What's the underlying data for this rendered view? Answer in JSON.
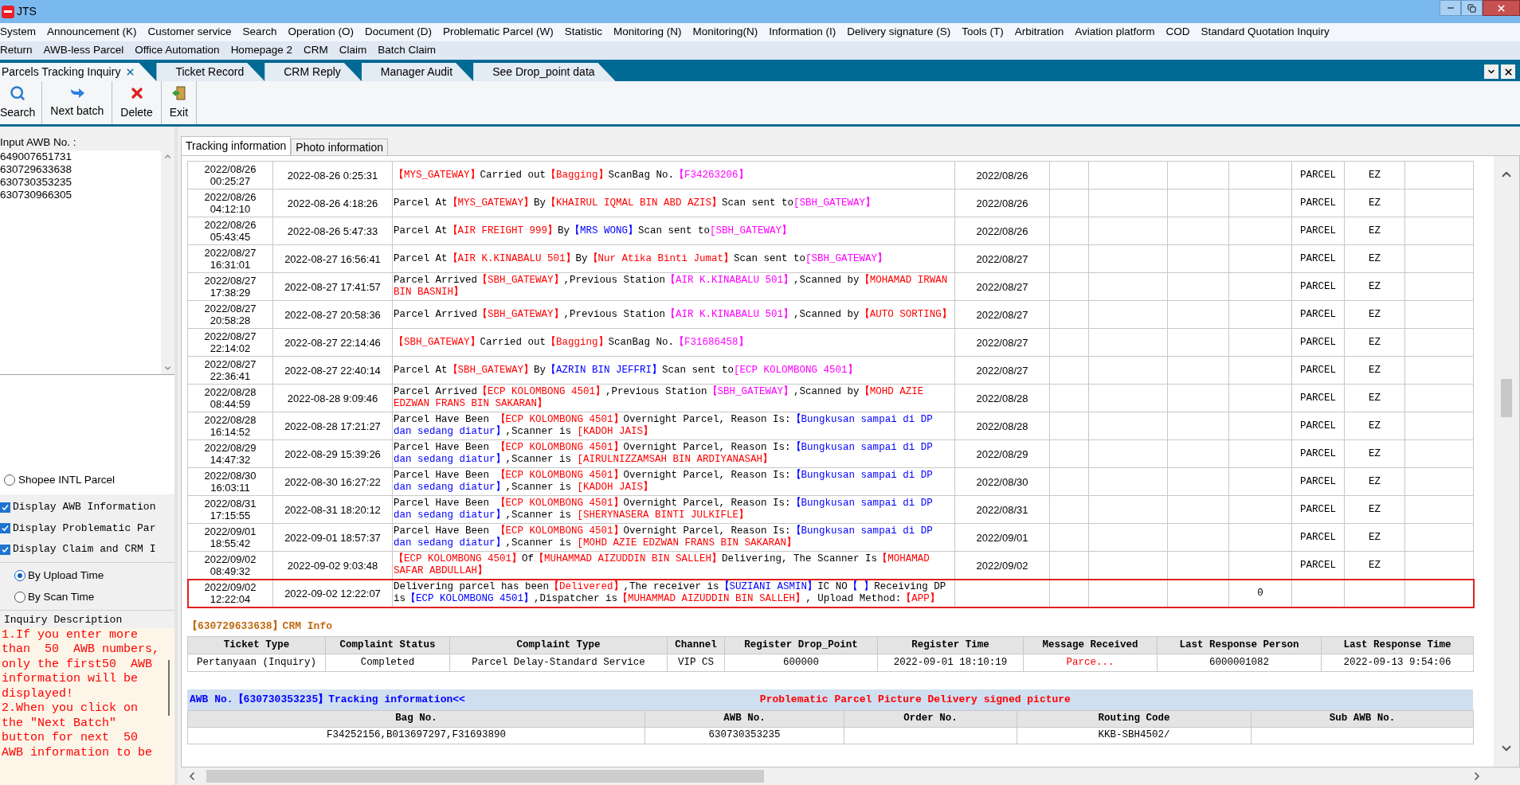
{
  "window": {
    "title": "JTS"
  },
  "menu_rows": [
    [
      "System",
      "Announcement (K)",
      "Customer service",
      "Search",
      "Operation (O)",
      "Document (D)",
      "Problematic Parcel (W)",
      "Statistic",
      "Monitoring (N)",
      "Monitoring(N)",
      "Information (I)",
      "Delivery signature (S)",
      "Tools (T)",
      "Arbitration",
      "Aviation platform",
      "COD",
      "Standard Quotation Inquiry"
    ],
    [
      "Return",
      "AWB-less Parcel",
      "Office Automation",
      "Homepage 2",
      "CRM",
      "Claim",
      "Batch Claim"
    ]
  ],
  "doc_tabs": [
    {
      "label": "Parcels Tracking Inquiry",
      "selected": true
    },
    {
      "label": "Ticket Record",
      "selected": false
    },
    {
      "label": "CRM Reply",
      "selected": false
    },
    {
      "label": "Manager Audit",
      "selected": false
    },
    {
      "label": "See Drop_point data",
      "selected": false
    }
  ],
  "toolbar": [
    {
      "kind": "search",
      "label": "Search"
    },
    {
      "kind": "next",
      "label": "Next batch"
    },
    {
      "kind": "delete",
      "label": "Delete"
    },
    {
      "kind": "exit",
      "label": "Exit"
    }
  ],
  "left_panel": {
    "awb_label": "Input AWB No. :",
    "awb_numbers": [
      "649007651731",
      "630729633638",
      "630730353235",
      "630730966305"
    ],
    "shopee_option": {
      "label": "Shopee INTL Parcel",
      "selected": false
    },
    "checkboxes": [
      {
        "label": "Display AWB Information",
        "checked": true
      },
      {
        "label": "Display Problematic Par",
        "checked": true
      },
      {
        "label": "Display Claim and CRM I",
        "checked": true
      }
    ],
    "sort_options": [
      {
        "label": "By Upload Time",
        "selected": true
      },
      {
        "label": "By Scan Time",
        "selected": false
      }
    ],
    "inquiry": {
      "title": "Inquiry Description",
      "text": "1.If you enter more than  50  AWB numbers, only the first50  AWB information will be displayed!\n2.When you click on the ″Next Batch″ button for next  50 AWB information to be"
    }
  },
  "content_tabs": [
    {
      "label": "Tracking information",
      "selected": true
    },
    {
      "label": "Photo information",
      "selected": false
    }
  ],
  "tracking": {
    "rows": [
      {
        "scan_date": "2022/08/26",
        "scan_time": "00:25:27",
        "upload_time": "2022-08-26 0:25:31",
        "description": [
          {
            "text": "【MYS_GATEWAY】",
            "color": "#ff0000"
          },
          {
            "text": "Carried out",
            "color": "#000000"
          },
          {
            "text": "【Bagging】",
            "color": "#ff0000"
          },
          {
            "text": "ScanBag No.",
            "color": "#000000"
          },
          {
            "text": "【F34263206】",
            "color": "#ff00ff"
          }
        ],
        "date": "2022/08/26",
        "type": "PARCEL",
        "code": "EZ",
        "highlighted": false
      },
      {
        "scan_date": "2022/08/26",
        "scan_time": "04:12:10",
        "upload_time": "2022-08-26 4:18:26",
        "description": [
          {
            "text": "Parcel At",
            "color": "#000000"
          },
          {
            "text": "【MYS_GATEWAY】",
            "color": "#ff0000"
          },
          {
            "text": "By",
            "color": "#000000"
          },
          {
            "text": "【KHAIRUL IQMAL BIN ABD AZIS】",
            "color": "#ff0000"
          },
          {
            "text": "Scan sent to",
            "color": "#000000"
          },
          {
            "text": "[SBH_GATEWAY】",
            "color": "#ff00ff"
          }
        ],
        "date": "2022/08/26",
        "type": "PARCEL",
        "code": "EZ",
        "highlighted": false
      },
      {
        "scan_date": "2022/08/26",
        "scan_time": "05:43:45",
        "upload_time": "2022-08-26 5:47:33",
        "description": [
          {
            "text": "Parcel At",
            "color": "#000000"
          },
          {
            "text": "【AIR FREIGHT 999】",
            "color": "#ff0000"
          },
          {
            "text": "By",
            "color": "#000000"
          },
          {
            "text": "【MRS WONG】",
            "color": "#0000ff"
          },
          {
            "text": "Scan sent to",
            "color": "#000000"
          },
          {
            "text": "[SBH_GATEWAY】",
            "color": "#ff00ff"
          }
        ],
        "date": "2022/08/26",
        "type": "PARCEL",
        "code": "EZ",
        "highlighted": false
      },
      {
        "scan_date": "2022/08/27",
        "scan_time": "16:31:01",
        "upload_time": "2022-08-27 16:56:41",
        "description": [
          {
            "text": "Parcel At",
            "color": "#000000"
          },
          {
            "text": "【AIR K.KINABALU 501】",
            "color": "#ff0000"
          },
          {
            "text": "By",
            "color": "#000000"
          },
          {
            "text": "【Nur Atika Binti Jumat】",
            "color": "#ff0000"
          },
          {
            "text": "Scan sent to",
            "color": "#000000"
          },
          {
            "text": "[SBH_GATEWAY】",
            "color": "#ff00ff"
          }
        ],
        "date": "2022/08/27",
        "type": "PARCEL",
        "code": "EZ",
        "highlighted": false
      },
      {
        "scan_date": "2022/08/27",
        "scan_time": "17:38:29",
        "upload_time": "2022-08-27 17:41:57",
        "description": [
          {
            "text": "Parcel Arrived",
            "color": "#000000"
          },
          {
            "text": "【SBH_GATEWAY】",
            "color": "#ff0000"
          },
          {
            "text": ",Previous Station",
            "color": "#000000"
          },
          {
            "text": "【AIR K.KINABALU 501】",
            "color": "#ff00ff"
          },
          {
            "text": ",Scanned by",
            "color": "#000000"
          },
          {
            "text": "【MOHAMAD IRWAN BIN BASNIH】",
            "color": "#ff0000"
          }
        ],
        "date": "2022/08/27",
        "type": "PARCEL",
        "code": "EZ",
        "highlighted": false
      },
      {
        "scan_date": "2022/08/27",
        "scan_time": "20:58:28",
        "upload_time": "2022-08-27 20:58:36",
        "description": [
          {
            "text": "Parcel Arrived",
            "color": "#000000"
          },
          {
            "text": "【SBH_GATEWAY】",
            "color": "#ff0000"
          },
          {
            "text": ",Previous Station",
            "color": "#000000"
          },
          {
            "text": "【AIR K.KINABALU 501】",
            "color": "#ff00ff"
          },
          {
            "text": ",Scanned by",
            "color": "#000000"
          },
          {
            "text": "【AUTO SORTING】",
            "color": "#ff0000"
          }
        ],
        "date": "2022/08/27",
        "type": "PARCEL",
        "code": "EZ",
        "highlighted": false
      },
      {
        "scan_date": "2022/08/27",
        "scan_time": "22:14:02",
        "upload_time": "2022-08-27 22:14:46",
        "description": [
          {
            "text": "【SBH_GATEWAY】",
            "color": "#ff0000"
          },
          {
            "text": "Carried out",
            "color": "#000000"
          },
          {
            "text": "【Bagging】",
            "color": "#ff0000"
          },
          {
            "text": "ScanBag No.",
            "color": "#000000"
          },
          {
            "text": "【F31686458】",
            "color": "#ff00ff"
          }
        ],
        "date": "2022/08/27",
        "type": "PARCEL",
        "code": "EZ",
        "highlighted": false
      },
      {
        "scan_date": "2022/08/27",
        "scan_time": "22:36:41",
        "upload_time": "2022-08-27 22:40:14",
        "description": [
          {
            "text": "Parcel At",
            "color": "#000000"
          },
          {
            "text": "【SBH_GATEWAY】",
            "color": "#ff0000"
          },
          {
            "text": "By",
            "color": "#000000"
          },
          {
            "text": "【AZRIN BIN JEFFRI】",
            "color": "#0000ff"
          },
          {
            "text": "Scan sent to",
            "color": "#000000"
          },
          {
            "text": "[ECP KOLOMBONG 4501】",
            "color": "#ff00ff"
          }
        ],
        "date": "2022/08/27",
        "type": "PARCEL",
        "code": "EZ",
        "highlighted": false
      },
      {
        "scan_date": "2022/08/28",
        "scan_time": "08:44:59",
        "upload_time": "2022-08-28 9:09:46",
        "description": [
          {
            "text": "Parcel Arrived",
            "color": "#000000"
          },
          {
            "text": "【ECP KOLOMBONG 4501】",
            "color": "#ff0000"
          },
          {
            "text": ",Previous Station",
            "color": "#000000"
          },
          {
            "text": "【SBH_GATEWAY】",
            "color": "#ff00ff"
          },
          {
            "text": ",Scanned by",
            "color": "#000000"
          },
          {
            "text": "【MOHD AZIE EDZWAN FRANS BIN SAKARAN】",
            "color": "#ff0000"
          }
        ],
        "date": "2022/08/28",
        "type": "PARCEL",
        "code": "EZ",
        "highlighted": false
      },
      {
        "scan_date": "2022/08/28",
        "scan_time": "16:14:52",
        "upload_time": "2022-08-28 17:21:27",
        "description": [
          {
            "text": "Parcel Have Been ",
            "color": "#000000"
          },
          {
            "text": "【ECP KOLOMBONG 4501】",
            "color": "#ff0000"
          },
          {
            "text": "Overnight Parcel, Reason Is:",
            "color": "#000000"
          },
          {
            "text": "【Bungkusan sampai di DP dan sedang diatur】",
            "color": "#0000ff"
          },
          {
            "text": ",Scanner is ",
            "color": "#000000"
          },
          {
            "text": "[KADOH JAIS】",
            "color": "#ff0000"
          }
        ],
        "date": "2022/08/28",
        "type": "PARCEL",
        "code": "EZ",
        "highlighted": false
      },
      {
        "scan_date": "2022/08/29",
        "scan_time": "14:47:32",
        "upload_time": "2022-08-29 15:39:26",
        "description": [
          {
            "text": "Parcel Have Been ",
            "color": "#000000"
          },
          {
            "text": "【ECP KOLOMBONG 4501】",
            "color": "#ff0000"
          },
          {
            "text": "Overnight Parcel, Reason Is:",
            "color": "#000000"
          },
          {
            "text": "【Bungkusan sampai di DP dan sedang diatur】",
            "color": "#0000ff"
          },
          {
            "text": ",Scanner is ",
            "color": "#000000"
          },
          {
            "text": "[AIRULNIZZAMSAH BIN ARDIYANASAH】",
            "color": "#ff0000"
          }
        ],
        "date": "2022/08/29",
        "type": "PARCEL",
        "code": "EZ",
        "highlighted": false
      },
      {
        "scan_date": "2022/08/30",
        "scan_time": "16:03:11",
        "upload_time": "2022-08-30 16:27:22",
        "description": [
          {
            "text": "Parcel Have Been ",
            "color": "#000000"
          },
          {
            "text": "【ECP KOLOMBONG 4501】",
            "color": "#ff0000"
          },
          {
            "text": "Overnight Parcel, Reason Is:",
            "color": "#000000"
          },
          {
            "text": "【Bungkusan sampai di DP dan sedang diatur】",
            "color": "#0000ff"
          },
          {
            "text": ",Scanner is ",
            "color": "#000000"
          },
          {
            "text": "[KADOH JAIS】",
            "color": "#ff0000"
          }
        ],
        "date": "2022/08/30",
        "type": "PARCEL",
        "code": "EZ",
        "highlighted": false
      },
      {
        "scan_date": "2022/08/31",
        "scan_time": "17:15:55",
        "upload_time": "2022-08-31 18:20:12",
        "description": [
          {
            "text": "Parcel Have Been ",
            "color": "#000000"
          },
          {
            "text": "【ECP KOLOMBONG 4501】",
            "color": "#ff0000"
          },
          {
            "text": "Overnight Parcel, Reason Is:",
            "color": "#000000"
          },
          {
            "text": "【Bungkusan sampai di DP dan sedang diatur】",
            "color": "#0000ff"
          },
          {
            "text": ",Scanner is ",
            "color": "#000000"
          },
          {
            "text": "[SHERYNASERA BINTI JULKIFLE】",
            "color": "#ff0000"
          }
        ],
        "date": "2022/08/31",
        "type": "PARCEL",
        "code": "EZ",
        "highlighted": false
      },
      {
        "scan_date": "2022/09/01",
        "scan_time": "18:55:42",
        "upload_time": "2022-09-01 18:57:37",
        "description": [
          {
            "text": "Parcel Have Been ",
            "color": "#000000"
          },
          {
            "text": "【ECP KOLOMBONG 4501】",
            "color": "#ff0000"
          },
          {
            "text": "Overnight Parcel, Reason Is:",
            "color": "#000000"
          },
          {
            "text": "【Bungkusan sampai di DP dan sedang diatur】",
            "color": "#0000ff"
          },
          {
            "text": ",Scanner is ",
            "color": "#000000"
          },
          {
            "text": "[MOHD AZIE EDZWAN FRANS BIN SAKARAN】",
            "color": "#ff0000"
          }
        ],
        "date": "2022/09/01",
        "type": "PARCEL",
        "code": "EZ",
        "highlighted": false
      },
      {
        "scan_date": "2022/09/02",
        "scan_time": "08:49:32",
        "upload_time": "2022-09-02 9:03:48",
        "description": [
          {
            "text": "【ECP KOLOMBONG 4501】",
            "color": "#ff0000"
          },
          {
            "text": "Of",
            "color": "#000000"
          },
          {
            "text": "【MUHAMMAD AIZUDDIN BIN SALLEH】",
            "color": "#ff0000"
          },
          {
            "text": "Delivering, The Scanner Is",
            "color": "#000000"
          },
          {
            "text": "【MOHAMAD SAFAR ABDULLAH】",
            "color": "#ff0000"
          }
        ],
        "date": "2022/09/02",
        "type": "PARCEL",
        "code": "EZ",
        "highlighted": false
      },
      {
        "scan_date": "2022/09/02",
        "scan_time": "12:22:04",
        "upload_time": "2022-09-02 12:22:07",
        "description": [
          {
            "text": "Delivering parcel has been",
            "color": "#000000"
          },
          {
            "text": "【Delivered】",
            "color": "#ff0000"
          },
          {
            "text": ",The receiver is",
            "color": "#000000"
          },
          {
            "text": "【SUZIANI ASMIN】",
            "color": "#0000ff"
          },
          {
            "text": "IC NO",
            "color": "#000000"
          },
          {
            "text": "【 】",
            "color": "#0000ff"
          },
          {
            "text": "Receiving DP is",
            "color": "#000000"
          },
          {
            "text": "【ECP KOLOMBONG 4501】",
            "color": "#0000ff"
          },
          {
            "text": ",Dispatcher is",
            "color": "#000000"
          },
          {
            "text": "【MUHAMMAD AIZUDDIN BIN SALLEH】",
            "color": "#ff0000"
          },
          {
            "text": ", Upload Method:",
            "color": "#000000"
          },
          {
            "text": "【APP】",
            "color": "#ff0000"
          }
        ],
        "count": "0",
        "highlighted": true
      }
    ]
  },
  "crm": {
    "title": "【630729633638】CRM Info",
    "columns": [
      "Ticket Type",
      "Complaint Status",
      "Complaint Type",
      "Channel",
      "Register Drop_Point",
      "Register Time",
      "Message Received",
      "Last Response Person",
      "Last Response Time"
    ],
    "row": [
      {
        "text": "Pertanyaan (Inquiry)",
        "color": "#000000"
      },
      {
        "text": "Completed",
        "color": "#000000"
      },
      {
        "text": "Parcel Delay-Standard Service",
        "color": "#000000"
      },
      {
        "text": "VIP CS",
        "color": "#000000"
      },
      {
        "text": "600000",
        "color": "#000000"
      },
      {
        "text": "2022-09-01 18:10:19",
        "color": "#000000"
      },
      {
        "text": "Parce...",
        "color": "#ff0000"
      },
      {
        "text": "6000001082",
        "color": "#000000"
      },
      {
        "text": "2022-09-13 9:54:06",
        "color": "#000000"
      }
    ]
  },
  "awb": {
    "title": "AWB No.【630730353235】Tracking information<<",
    "picture_link": "Problematic Parcel Picture Delivery signed picture",
    "columns": [
      {
        "label": "Bag No.",
        "value": "F34252156,B013697297,F31693890"
      },
      {
        "label": "AWB No.",
        "value": "630730353235"
      },
      {
        "label": "Order No."
      },
      {
        "label": "Routing Code",
        "value": "KKB-SBH4502/"
      },
      {
        "label": "Sub AWB No."
      }
    ]
  }
}
